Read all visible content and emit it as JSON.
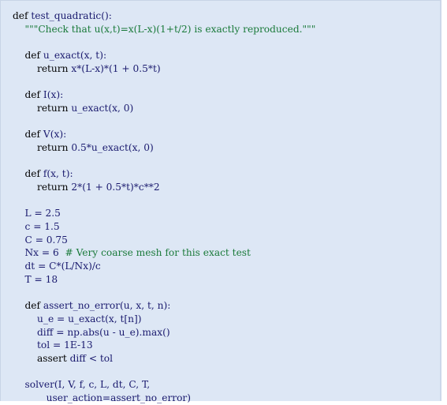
{
  "code": {
    "language": "python",
    "lines": [
      {
        "indent": "",
        "parts": [
          {
            "t": "kw",
            "v": "def"
          },
          {
            "t": "tx",
            "v": " test_quadratic():"
          }
        ]
      },
      {
        "indent": "    ",
        "parts": [
          {
            "t": "str",
            "v": "\"\"\"Check that u(x,t)=x(L-x)(1+t/2) is exactly reproduced.\"\"\""
          }
        ]
      },
      {
        "indent": "",
        "parts": []
      },
      {
        "indent": "    ",
        "parts": [
          {
            "t": "kw",
            "v": "def"
          },
          {
            "t": "tx",
            "v": " u_exact(x, t):"
          }
        ]
      },
      {
        "indent": "        ",
        "parts": [
          {
            "t": "kw",
            "v": "return"
          },
          {
            "t": "tx",
            "v": " x*(L-x)*(1 + 0.5*t)"
          }
        ]
      },
      {
        "indent": "",
        "parts": []
      },
      {
        "indent": "    ",
        "parts": [
          {
            "t": "kw",
            "v": "def"
          },
          {
            "t": "tx",
            "v": " I(x):"
          }
        ]
      },
      {
        "indent": "        ",
        "parts": [
          {
            "t": "kw",
            "v": "return"
          },
          {
            "t": "tx",
            "v": " u_exact(x, 0)"
          }
        ]
      },
      {
        "indent": "",
        "parts": []
      },
      {
        "indent": "    ",
        "parts": [
          {
            "t": "kw",
            "v": "def"
          },
          {
            "t": "tx",
            "v": " V(x):"
          }
        ]
      },
      {
        "indent": "        ",
        "parts": [
          {
            "t": "kw",
            "v": "return"
          },
          {
            "t": "tx",
            "v": " 0.5*u_exact(x, 0)"
          }
        ]
      },
      {
        "indent": "",
        "parts": []
      },
      {
        "indent": "    ",
        "parts": [
          {
            "t": "kw",
            "v": "def"
          },
          {
            "t": "tx",
            "v": " f(x, t):"
          }
        ]
      },
      {
        "indent": "        ",
        "parts": [
          {
            "t": "kw",
            "v": "return"
          },
          {
            "t": "tx",
            "v": " 2*(1 + 0.5*t)*c**2"
          }
        ]
      },
      {
        "indent": "",
        "parts": []
      },
      {
        "indent": "    ",
        "parts": [
          {
            "t": "tx",
            "v": "L = 2.5"
          }
        ]
      },
      {
        "indent": "    ",
        "parts": [
          {
            "t": "tx",
            "v": "c = 1.5"
          }
        ]
      },
      {
        "indent": "    ",
        "parts": [
          {
            "t": "tx",
            "v": "C = 0.75"
          }
        ]
      },
      {
        "indent": "    ",
        "parts": [
          {
            "t": "tx",
            "v": "Nx = 6  "
          },
          {
            "t": "cm",
            "v": "# Very coarse mesh for this exact test"
          }
        ]
      },
      {
        "indent": "    ",
        "parts": [
          {
            "t": "tx",
            "v": "dt = C*(L/Nx)/c"
          }
        ]
      },
      {
        "indent": "    ",
        "parts": [
          {
            "t": "tx",
            "v": "T = 18"
          }
        ]
      },
      {
        "indent": "",
        "parts": []
      },
      {
        "indent": "    ",
        "parts": [
          {
            "t": "kw",
            "v": "def"
          },
          {
            "t": "tx",
            "v": " assert_no_error(u, x, t, n):"
          }
        ]
      },
      {
        "indent": "        ",
        "parts": [
          {
            "t": "tx",
            "v": "u_e = u_exact(x, t[n])"
          }
        ]
      },
      {
        "indent": "        ",
        "parts": [
          {
            "t": "tx",
            "v": "diff = np.abs(u - u_e).max()"
          }
        ]
      },
      {
        "indent": "        ",
        "parts": [
          {
            "t": "tx",
            "v": "tol = 1E-13"
          }
        ]
      },
      {
        "indent": "        ",
        "parts": [
          {
            "t": "kw",
            "v": "assert"
          },
          {
            "t": "tx",
            "v": " diff < tol"
          }
        ]
      },
      {
        "indent": "",
        "parts": []
      },
      {
        "indent": "    ",
        "parts": [
          {
            "t": "tx",
            "v": "solver(I, V, f, c, L, dt, C, T,"
          }
        ]
      },
      {
        "indent": "           ",
        "parts": [
          {
            "t": "tx",
            "v": "user_action=assert_no_error)"
          }
        ]
      }
    ]
  },
  "colors": {
    "background": "#dde7f5",
    "keyword": "#000000",
    "text": "#1a1a6e",
    "string": "#1a7a3a",
    "comment": "#1a7a3a"
  }
}
